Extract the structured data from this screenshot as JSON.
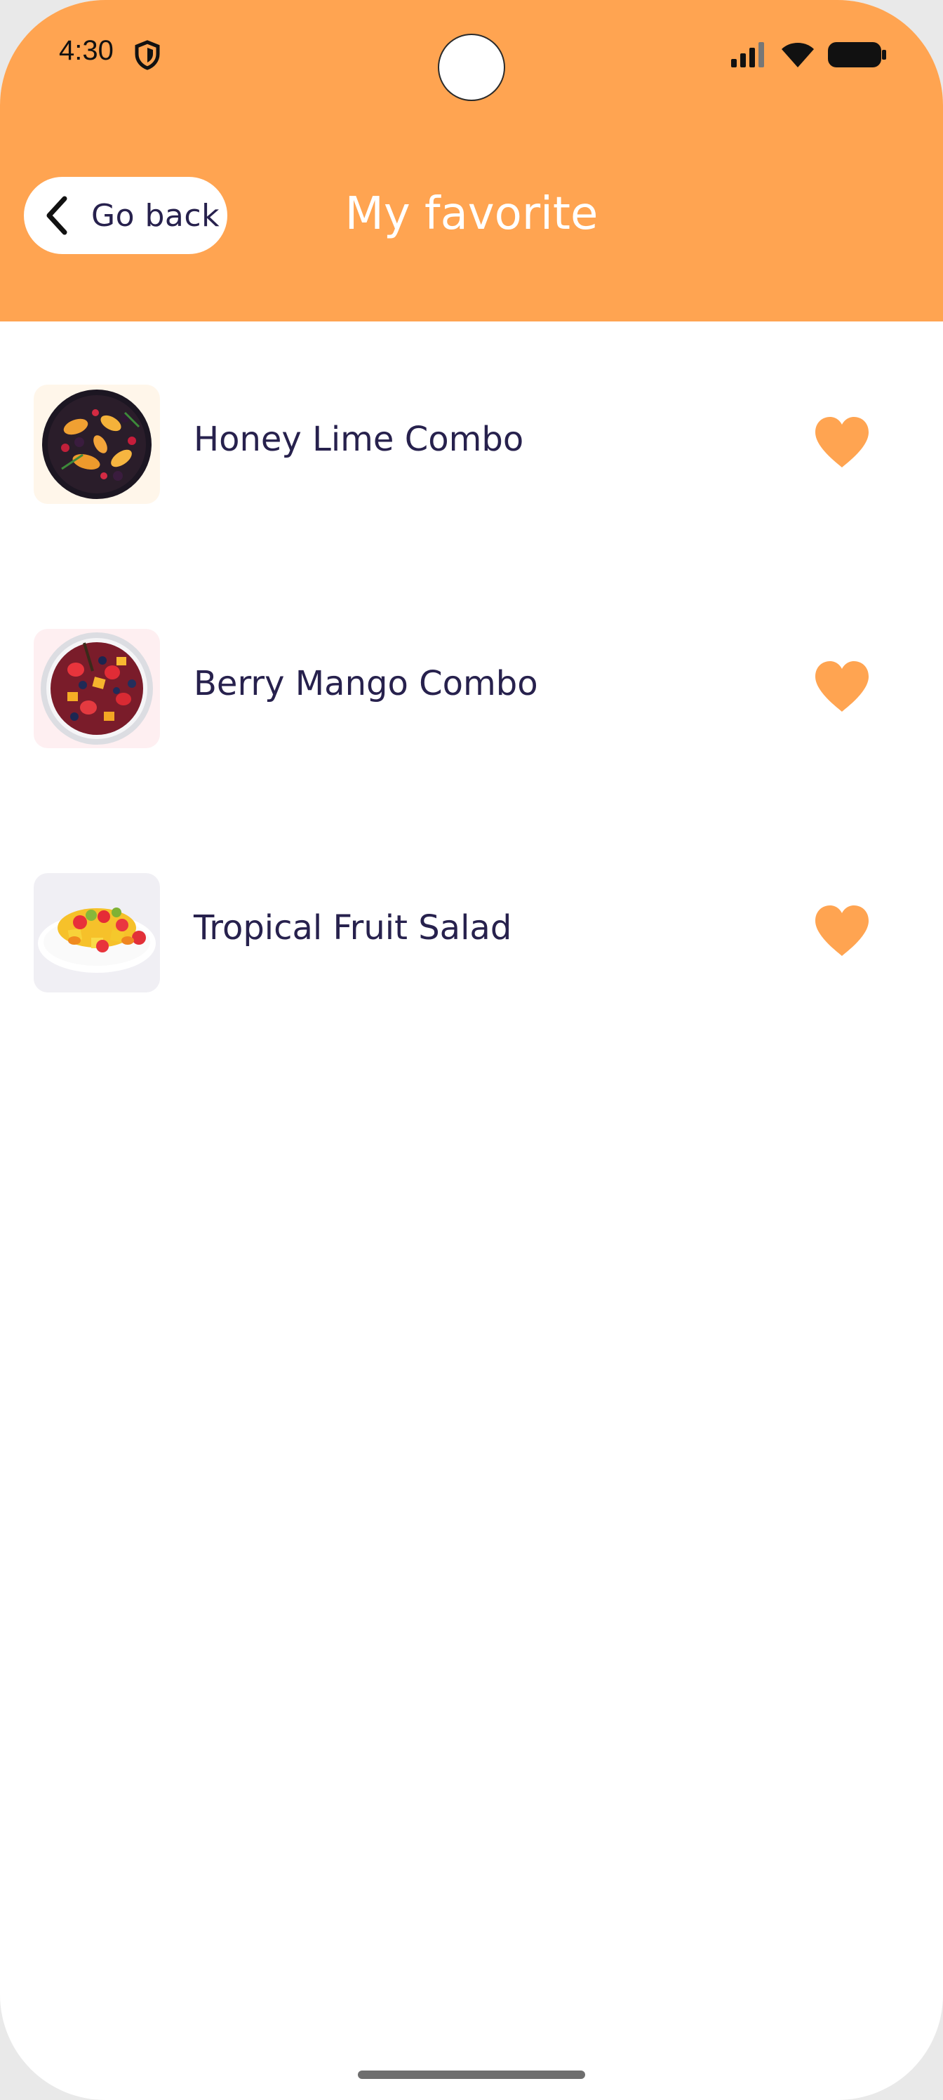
{
  "status_bar": {
    "time": "4:30"
  },
  "header": {
    "back_label": "Go back",
    "title": "My favorite",
    "background_color": "#ffa451"
  },
  "favorites": [
    {
      "name": "Honey Lime Combo",
      "favorited": true
    },
    {
      "name": "Berry Mango Combo",
      "favorited": true
    },
    {
      "name": "Tropical Fruit Salad",
      "favorited": true
    }
  ],
  "icons": {
    "back": "chevron-left-icon",
    "favorite": "heart-icon",
    "shield": "shield-icon",
    "signal": "signal-icon",
    "wifi": "wifi-icon",
    "battery": "battery-icon"
  },
  "colors": {
    "accent": "#ffa451",
    "text_dark": "#27214d"
  }
}
